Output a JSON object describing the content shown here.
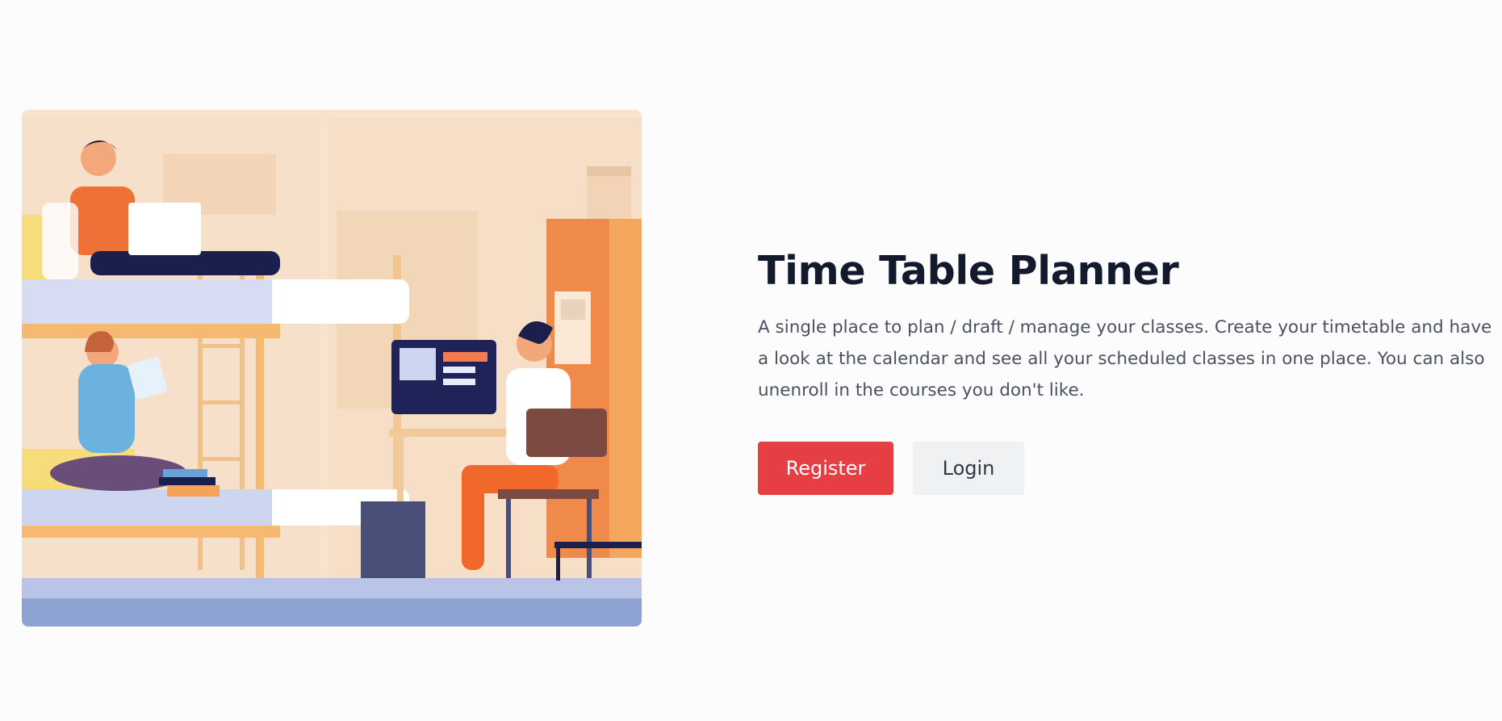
{
  "hero": {
    "image_alt": "Students studying in a dorm room with bunk beds"
  },
  "main": {
    "title": "Time Table Planner",
    "description": "A single place to plan / draft / manage your classes. Create your timetable and have a look at the calendar and see all your scheduled classes in one place. You can also unenroll in the courses you don't like.",
    "register_label": "Register",
    "login_label": "Login"
  },
  "colors": {
    "primary": "#e53e43",
    "secondary": "#f0f1f3",
    "title": "#131a2e",
    "text": "#4a5160",
    "background": "#fcfcfd"
  }
}
